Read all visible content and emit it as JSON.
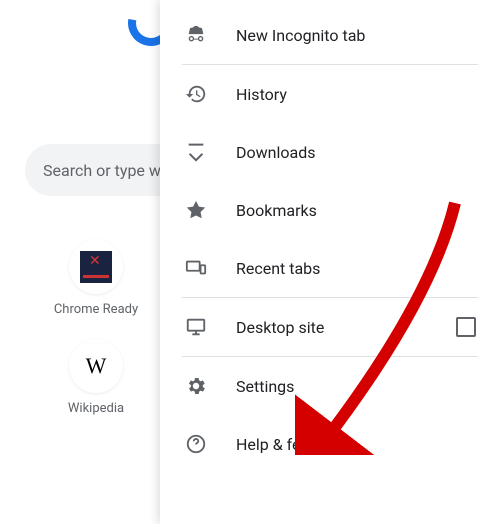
{
  "search": {
    "placeholder": "Search or type w"
  },
  "shortcuts": [
    {
      "label": "Chrome Ready"
    },
    {
      "label": "Wikipedia"
    }
  ],
  "menu": {
    "new_incognito": "New Incognito tab",
    "history": "History",
    "downloads": "Downloads",
    "bookmarks": "Bookmarks",
    "recent_tabs": "Recent tabs",
    "desktop_site": "Desktop site",
    "settings": "Settings",
    "help_feedback": "Help & feedback"
  }
}
